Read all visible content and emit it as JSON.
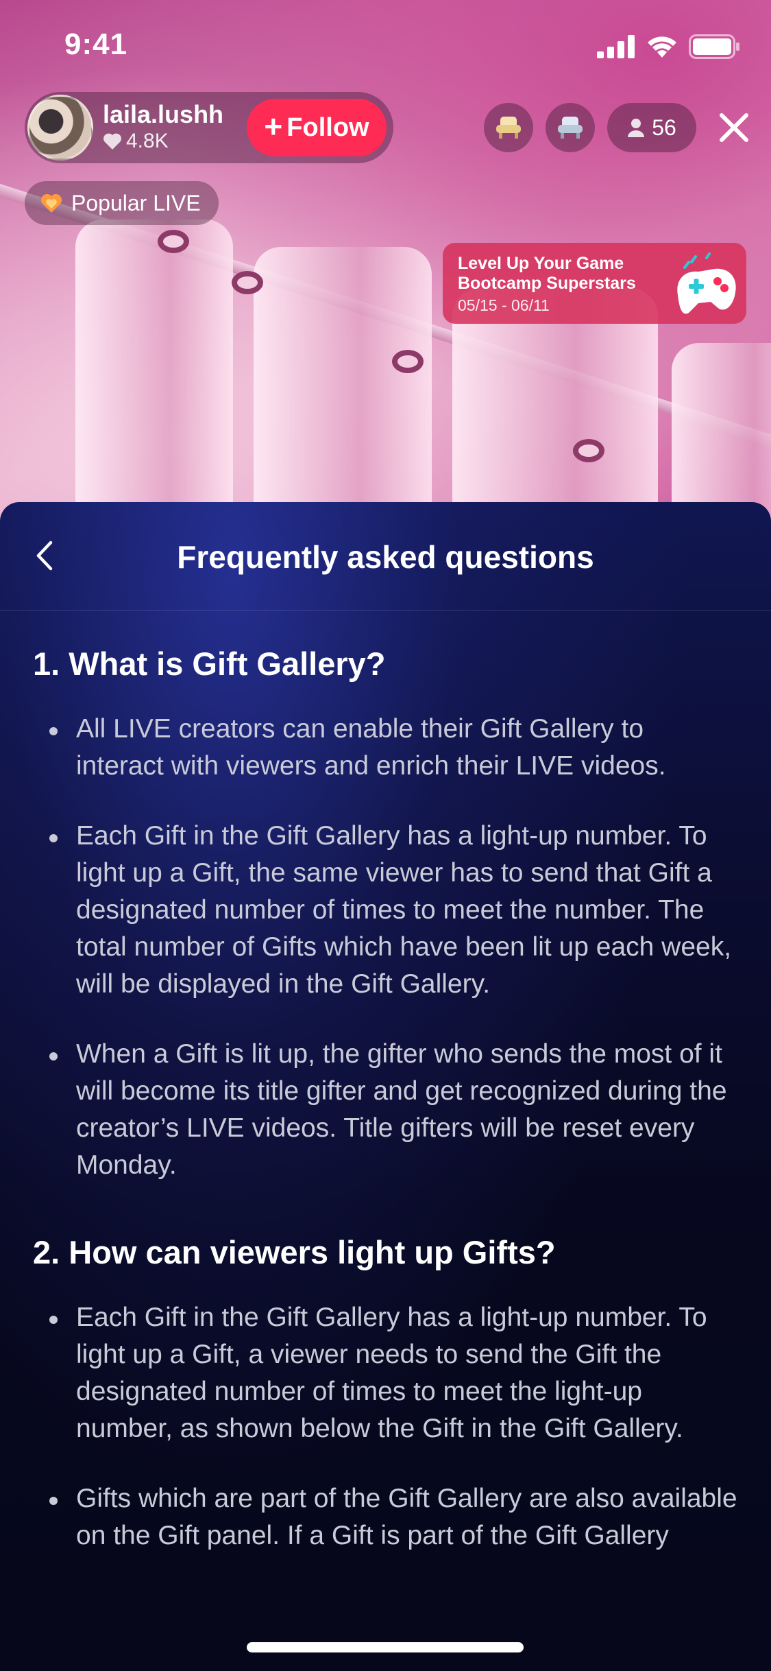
{
  "status_bar": {
    "time": "9:41",
    "icons": [
      "signal-icon",
      "wifi-icon",
      "battery-icon"
    ]
  },
  "live_header": {
    "host_name": "laila.lushh",
    "host_likes": "4.8K",
    "follow_label": "Follow",
    "viewer_count": "56",
    "popular_label": "Popular LIVE",
    "icons": [
      "heart-icon",
      "plus-icon",
      "seat-icon",
      "person-icon",
      "close-icon",
      "flame-heart-icon"
    ]
  },
  "promo": {
    "line1": "Level Up Your Game",
    "line2": "Bootcamp Superstars",
    "dates": "05/15 - 06/11",
    "icon": "gamepad-icon"
  },
  "sheet": {
    "title": "Frequently asked questions",
    "back_icon": "chevron-left-icon",
    "sections": [
      {
        "heading": "1. What is Gift Gallery?",
        "bullets": [
          "All LIVE creators can enable their Gift Gallery to interact with viewers and enrich their LIVE videos.",
          "Each Gift in the Gift Gallery has a light-up number. To light up a Gift, the same viewer has to send that Gift a designated number of times to meet the number. The total number of Gifts which have been lit up each week, will be displayed in the Gift Gallery.",
          "When a Gift is lit up, the gifter who sends the most of it will become its title gifter and get recognized during the creator’s LIVE videos. Title gifters will be reset every Monday."
        ]
      },
      {
        "heading": "2. How can viewers light up Gifts?",
        "bullets": [
          "Each Gift in the Gift Gallery has a light-up number. To light up a Gift, a viewer needs to send the Gift the designated number of times to meet the light-up number, as shown below the Gift in the Gift Gallery.",
          "Gifts which are part of the Gift Gallery are also available on the Gift panel. If a Gift is part of the Gift Gallery"
        ]
      }
    ]
  },
  "colors": {
    "accent": "#fe2c55",
    "promo": "#d6325c",
    "sheet_top": "#101650",
    "sheet_bottom": "#06071a",
    "body_text": "#c9cbd8"
  }
}
